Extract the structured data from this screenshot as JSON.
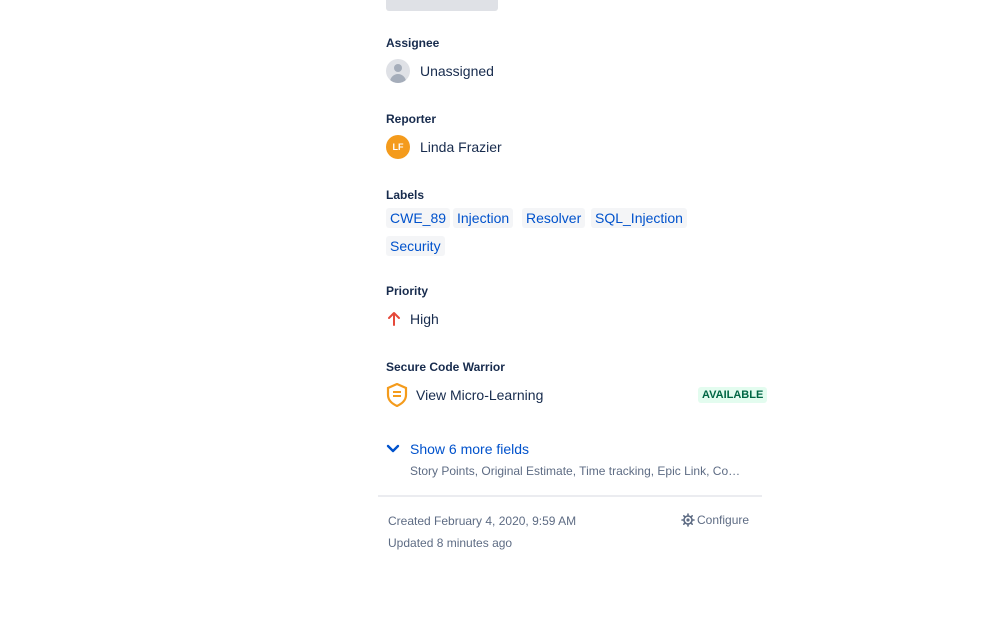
{
  "assignee": {
    "label": "Assignee",
    "value": "Unassigned"
  },
  "reporter": {
    "label": "Reporter",
    "initials": "LF",
    "name": "Linda Frazier"
  },
  "labels": {
    "label": "Labels",
    "items": [
      "CWE_89",
      "Injection",
      "Resolver",
      "SQL_Injection",
      "Security"
    ]
  },
  "priority": {
    "label": "Priority",
    "value": "High",
    "icon": "arrow-up-icon",
    "color": "#e5493a"
  },
  "scw": {
    "label": "Secure Code Warrior",
    "link": "View Micro-Learning",
    "badge": "AVAILABLE",
    "icon": "shield-icon"
  },
  "more": {
    "link": "Show 6 more fields",
    "sub": "Story Points, Original Estimate, Time tracking, Epic Link, Components, Fix versions"
  },
  "footer": {
    "created": "Created February 4, 2020, 9:59 AM",
    "updated": "Updated 8 minutes ago",
    "configure": "Configure"
  }
}
